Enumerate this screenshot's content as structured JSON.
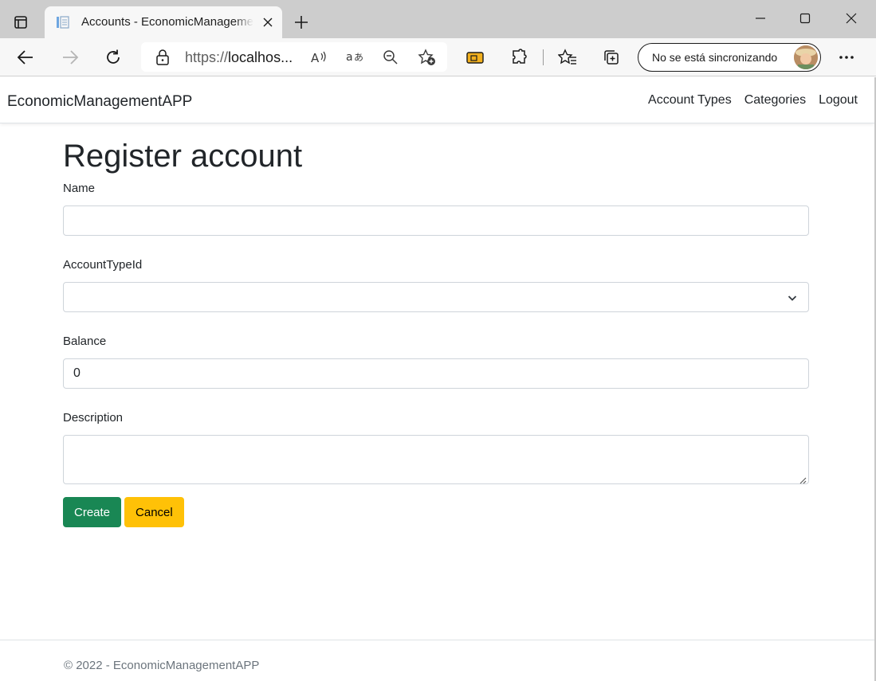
{
  "browser": {
    "tab_title": "Accounts - EconomicManagementAPP",
    "url_scheme": "https://",
    "url_host": "localhos...",
    "profile_label": "No se está sincronizando"
  },
  "navbar": {
    "brand": "EconomicManagementAPP",
    "links": [
      "Account Types",
      "Categories",
      "Logout"
    ]
  },
  "form": {
    "title": "Register account",
    "name_label": "Name",
    "name_value": "",
    "account_type_label": "AccountTypeId",
    "account_type_value": "",
    "balance_label": "Balance",
    "balance_value": "0",
    "description_label": "Description",
    "description_value": "",
    "create_label": "Create",
    "cancel_label": "Cancel"
  },
  "footer": {
    "text": "© 2022 - EconomicManagementAPP"
  },
  "colors": {
    "success": "#198754",
    "warning": "#ffc107"
  },
  "icons": [
    "tab-actions-icon",
    "page-favicon-icon",
    "close-icon",
    "plus-icon",
    "minimize-icon",
    "maximize-icon",
    "window-close-icon",
    "back-arrow-icon",
    "forward-arrow-icon",
    "refresh-icon",
    "lock-icon",
    "read-aloud-icon",
    "translate-icon",
    "zoom-out-icon",
    "add-favorite-icon",
    "wallet-icon",
    "extensions-icon",
    "favorites-icon",
    "collections-icon",
    "more-icon",
    "chevron-down-icon"
  ]
}
